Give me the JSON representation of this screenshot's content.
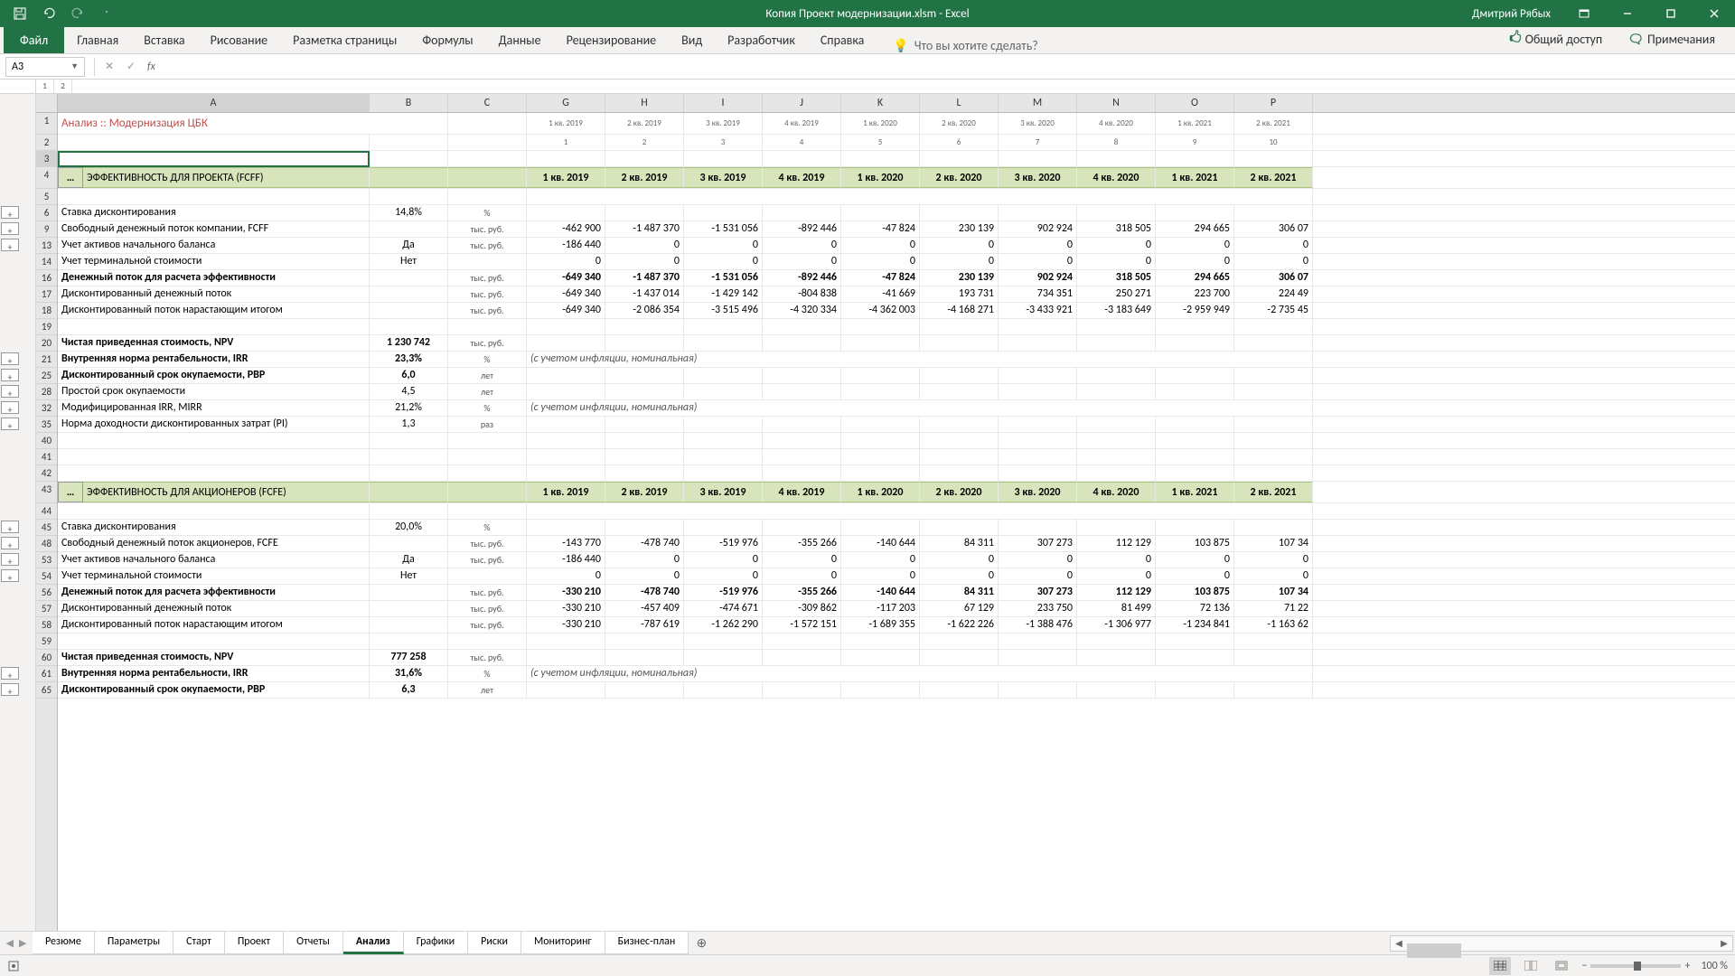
{
  "title": "Копия Проект модернизации.xlsm - Excel",
  "user": "Дмитрий Рябых",
  "ribbon": {
    "file": "Файл",
    "tabs": [
      "Главная",
      "Вставка",
      "Рисование",
      "Разметка страницы",
      "Формулы",
      "Данные",
      "Рецензирование",
      "Вид",
      "Разработчик",
      "Справка"
    ],
    "tell_me": "Что вы хотите сделать?",
    "share": "Общий доступ",
    "comments": "Примечания"
  },
  "namebox": "A3",
  "cols": [
    "A",
    "B",
    "C",
    "G",
    "H",
    "I",
    "J",
    "K",
    "L",
    "M",
    "N",
    "O",
    "P"
  ],
  "periods_top": [
    "1 кв. 2019",
    "2 кв. 2019",
    "3 кв. 2019",
    "4 кв. 2019",
    "1 кв. 2020",
    "2 кв. 2020",
    "3 кв. 2020",
    "4 кв. 2020",
    "1 кв. 2021",
    "2 кв. 2021"
  ],
  "periods_num": [
    "1",
    "2",
    "3",
    "4",
    "5",
    "6",
    "7",
    "8",
    "9",
    "10"
  ],
  "doc_title": "Анализ :: Модернизация ЦБК",
  "section1": "ЭФФЕКТИВНОСТЬ ДЛЯ ПРОЕКТА (FCFF)",
  "section2": "ЭФФЕКТИВНОСТЬ ДЛЯ АКЦИОНЕРОВ (FCFE)",
  "note_nominal": "(с учетом инфляции, номинальная)",
  "rows": {
    "r6": {
      "rn": "6",
      "a": "Ставка дисконтирования",
      "b": "14,8%",
      "c": "%"
    },
    "r9": {
      "rn": "9",
      "a": "Свободный денежный поток компании, FCFF",
      "c": "тыс. руб.",
      "d": [
        "-462 900",
        "-1 487 370",
        "-1 531 056",
        "-892 446",
        "-47 824",
        "230 139",
        "902 924",
        "318 505",
        "294 665",
        "306 07"
      ]
    },
    "r13": {
      "rn": "13",
      "a": "Учет активов начального баланса",
      "b": "Да",
      "c": "тыс. руб.",
      "d": [
        "-186 440",
        "0",
        "0",
        "0",
        "0",
        "0",
        "0",
        "0",
        "0",
        "0"
      ]
    },
    "r14": {
      "rn": "14",
      "a": "Учет терминальной стоимости",
      "b": "Нет",
      "d": [
        "0",
        "0",
        "0",
        "0",
        "0",
        "0",
        "0",
        "0",
        "0",
        "0"
      ]
    },
    "r16": {
      "rn": "16",
      "a": "Денежный поток для расчета эффективности",
      "c": "тыс. руб.",
      "d": [
        "-649 340",
        "-1 487 370",
        "-1 531 056",
        "-892 446",
        "-47 824",
        "230 139",
        "902 924",
        "318 505",
        "294 665",
        "306 07"
      ],
      "bold": true
    },
    "r17": {
      "rn": "17",
      "a": "Дисконтированный денежный поток",
      "c": "тыс. руб.",
      "d": [
        "-649 340",
        "-1 437 014",
        "-1 429 142",
        "-804 838",
        "-41 669",
        "193 731",
        "734 351",
        "250 271",
        "223 700",
        "224 49"
      ]
    },
    "r18": {
      "rn": "18",
      "a": "Дисконтированный поток нарастающим итогом",
      "c": "тыс. руб.",
      "d": [
        "-649 340",
        "-2 086 354",
        "-3 515 496",
        "-4 320 334",
        "-4 362 003",
        "-4 168 271",
        "-3 433 921",
        "-3 183 649",
        "-2 959 949",
        "-2 735 45"
      ]
    },
    "r19": {
      "rn": "19"
    },
    "r20": {
      "rn": "20",
      "a": "Чистая приведенная стоимость, NPV",
      "b": "1 230 742",
      "c": "тыс. руб.",
      "bold": true
    },
    "r21": {
      "rn": "21",
      "a": "Внутренняя норма рентабельности, IRR",
      "b": "23,3%",
      "c": "%",
      "bold": true,
      "note": true
    },
    "r25": {
      "rn": "25",
      "a": "Дисконтированный срок окупаемости, PBP",
      "b": "6,0",
      "c": "лет",
      "bold": true
    },
    "r28": {
      "rn": "28",
      "a": "Простой срок окупаемости",
      "b": "4,5",
      "c": "лет"
    },
    "r32": {
      "rn": "32",
      "a": "Модифицированная IRR, MIRR",
      "b": "21,2%",
      "c": "%",
      "note": true
    },
    "r35": {
      "rn": "35",
      "a": "Норма доходности дисконтированных затрат (PI)",
      "b": "1,3",
      "c": "раз"
    },
    "r40": {
      "rn": "40"
    },
    "r41": {
      "rn": "41"
    },
    "r42": {
      "rn": "42"
    },
    "r45": {
      "rn": "45",
      "a": "Ставка дисконтирования",
      "b": "20,0%",
      "c": "%"
    },
    "r48": {
      "rn": "48",
      "a": "Свободный денежный поток акционеров, FCFE",
      "c": "тыс. руб.",
      "d": [
        "-143 770",
        "-478 740",
        "-519 976",
        "-355 266",
        "-140 644",
        "84 311",
        "307 273",
        "112 129",
        "103 875",
        "107 34"
      ]
    },
    "r53": {
      "rn": "53",
      "a": "Учет активов начального баланса",
      "b": "Да",
      "c": "тыс. руб.",
      "d": [
        "-186 440",
        "0",
        "0",
        "0",
        "0",
        "0",
        "0",
        "0",
        "0",
        "0"
      ]
    },
    "r54": {
      "rn": "54",
      "a": "Учет терминальной стоимости",
      "b": "Нет",
      "d": [
        "0",
        "0",
        "0",
        "0",
        "0",
        "0",
        "0",
        "0",
        "0",
        "0"
      ]
    },
    "r56": {
      "rn": "56",
      "a": "Денежный поток для расчета эффективности",
      "c": "тыс. руб.",
      "d": [
        "-330 210",
        "-478 740",
        "-519 976",
        "-355 266",
        "-140 644",
        "84 311",
        "307 273",
        "112 129",
        "103 875",
        "107 34"
      ],
      "bold": true
    },
    "r57": {
      "rn": "57",
      "a": "Дисконтированный денежный поток",
      "c": "тыс. руб.",
      "d": [
        "-330 210",
        "-457 409",
        "-474 671",
        "-309 862",
        "-117 203",
        "67 129",
        "233 750",
        "81 499",
        "72 136",
        "71 22"
      ]
    },
    "r58": {
      "rn": "58",
      "a": "Дисконтированный поток нарастающим итогом",
      "c": "тыс. руб.",
      "d": [
        "-330 210",
        "-787 619",
        "-1 262 290",
        "-1 572 151",
        "-1 689 355",
        "-1 622 226",
        "-1 388 476",
        "-1 306 977",
        "-1 234 841",
        "-1 163 62"
      ]
    },
    "r59": {
      "rn": "59"
    },
    "r60": {
      "rn": "60",
      "a": "Чистая приведенная стоимость, NPV",
      "b": "777 258",
      "c": "тыс. руб.",
      "bold": true
    },
    "r61": {
      "rn": "61",
      "a": "Внутренняя норма рентабельности, IRR",
      "b": "31,6%",
      "c": "%",
      "bold": true,
      "note": true
    },
    "r65": {
      "rn": "65",
      "a": "Дисконтированный срок окупаемости, PBP",
      "b": "6,3",
      "c": "лет",
      "bold": true
    }
  },
  "sheets": [
    "Резюме",
    "Параметры",
    "Старт",
    "Проект",
    "Отчеты",
    "Анализ",
    "Графики",
    "Риски",
    "Мониторинг",
    "Бизнес-план"
  ],
  "active_sheet": 5,
  "zoom": "100 %"
}
